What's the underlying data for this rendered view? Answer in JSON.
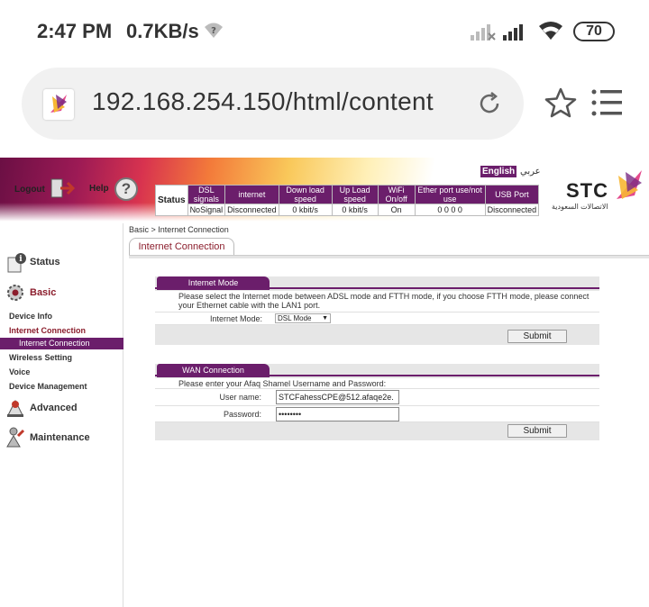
{
  "statusbar": {
    "time": "2:47 PM",
    "speed": "0.7KB/s",
    "battery": "70"
  },
  "browser": {
    "url": "192.168.254.150/html/content",
    "icons": [
      "favicon-icon",
      "reload-icon",
      "star-icon",
      "menu-icon"
    ]
  },
  "header": {
    "logout_label": "Logout",
    "help_label": "Help",
    "lang_english": "English",
    "lang_arabic": "عربي",
    "brand_word": "STC",
    "brand_arabic": "الاتصالات السعودية",
    "brand_color": "#6b1e6b"
  },
  "status_table": {
    "row_label": "Status",
    "headers": [
      "DSL signals",
      "internet",
      "Down load speed",
      "Up Load speed",
      "WiFi On/off",
      "Ether port use/not use",
      "USB Port"
    ],
    "values": [
      "NoSignal",
      "Disconnected",
      "0 kbit/s",
      "0 kbit/s",
      "On",
      "0 0 0 0",
      "Disconnected"
    ]
  },
  "nav": {
    "status": "Status",
    "basic": "Basic",
    "device_info": "Device Info",
    "internet_connection": "Internet Connection",
    "internet_connection_sub": "Internet Connection",
    "wireless_setting": "Wireless Setting",
    "voice": "Voice",
    "device_management": "Device Management",
    "advanced": "Advanced",
    "maintenance": "Maintenance"
  },
  "content": {
    "breadcrumb": "Basic > Internet Connection",
    "tab_label": "Internet Connection",
    "internet_mode": {
      "title": "Internet Mode",
      "description": "Please select the Internet mode between ADSL mode and FTTH mode, if you choose FTTH mode, please connect your Ethernet cable with the LAN1 port.",
      "mode_label": "Internet Mode:",
      "mode_value": "DSL Mode",
      "submit": "Submit"
    },
    "wan": {
      "title": "WAN Connection",
      "description": "Please enter your Afaq Shamel Username and Password:",
      "username_label": "User name:",
      "username_value": "STCFahessCPE@512.afaqe2e.",
      "password_label": "Password:",
      "password_value": "••••••••",
      "submit": "Submit"
    }
  }
}
